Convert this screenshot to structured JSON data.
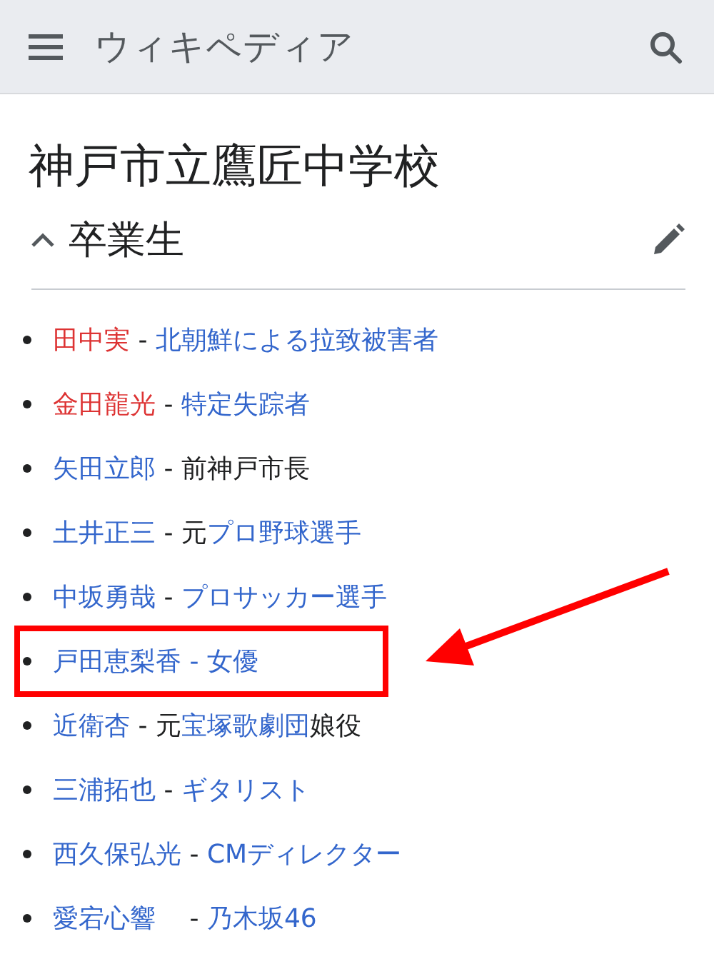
{
  "header": {
    "logo": "ウィキペディア"
  },
  "page": {
    "title": "神戸市立鷹匠中学校"
  },
  "section": {
    "heading": "卒業生",
    "expanded": true
  },
  "items": [
    {
      "highlighted": false,
      "segments": [
        {
          "kind": "redlink",
          "text": "田中実"
        },
        {
          "kind": "text",
          "text": " - "
        },
        {
          "kind": "link",
          "text": "北朝鮮による拉致被害者"
        }
      ]
    },
    {
      "highlighted": false,
      "segments": [
        {
          "kind": "redlink",
          "text": "金田龍光"
        },
        {
          "kind": "text",
          "text": " - "
        },
        {
          "kind": "link",
          "text": "特定失踪者"
        }
      ]
    },
    {
      "highlighted": false,
      "segments": [
        {
          "kind": "link",
          "text": "矢田立郎"
        },
        {
          "kind": "text",
          "text": " - 前神戸市長"
        }
      ]
    },
    {
      "highlighted": false,
      "segments": [
        {
          "kind": "link",
          "text": "土井正三"
        },
        {
          "kind": "text",
          "text": " - 元"
        },
        {
          "kind": "link",
          "text": "プロ野球選手"
        }
      ]
    },
    {
      "highlighted": false,
      "segments": [
        {
          "kind": "link",
          "text": "中坂勇哉"
        },
        {
          "kind": "text",
          "text": " - "
        },
        {
          "kind": "link",
          "text": "プロサッカー選手"
        }
      ]
    },
    {
      "highlighted": true,
      "segments": [
        {
          "kind": "link",
          "text": "戸田恵梨香 - 女優"
        }
      ]
    },
    {
      "highlighted": false,
      "segments": [
        {
          "kind": "link",
          "text": "近衛杏"
        },
        {
          "kind": "text",
          "text": " - 元"
        },
        {
          "kind": "link",
          "text": "宝塚歌劇団"
        },
        {
          "kind": "text",
          "text": "娘役"
        }
      ]
    },
    {
      "highlighted": false,
      "segments": [
        {
          "kind": "link",
          "text": "三浦拓也"
        },
        {
          "kind": "text",
          "text": " - "
        },
        {
          "kind": "link",
          "text": "ギタリスト"
        }
      ]
    },
    {
      "highlighted": false,
      "segments": [
        {
          "kind": "link",
          "text": "西久保弘光"
        },
        {
          "kind": "text",
          "text": " - "
        },
        {
          "kind": "link",
          "text": "CMディレクター"
        }
      ]
    },
    {
      "highlighted": false,
      "segments": [
        {
          "kind": "link",
          "text": "愛宕心響"
        },
        {
          "kind": "text",
          "text": " 　- "
        },
        {
          "kind": "link",
          "text": "乃木坂46"
        }
      ]
    }
  ]
}
